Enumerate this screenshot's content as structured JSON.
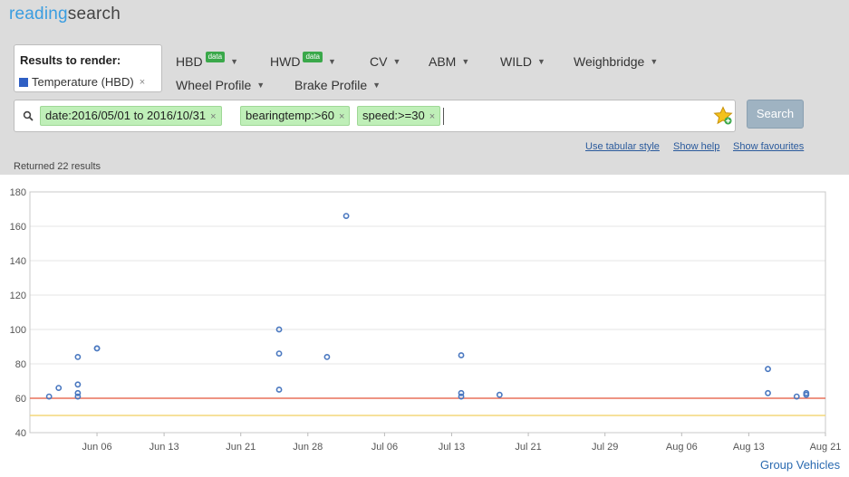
{
  "app": {
    "brand_part1": "reading",
    "brand_part2": "search"
  },
  "render_box": {
    "title": "Results to render:",
    "item": "Temperature (HBD)",
    "item_color": "#2f5fc4"
  },
  "menus": [
    {
      "label": "HBD",
      "badge": "data"
    },
    {
      "label": "HWD",
      "badge": "data"
    },
    {
      "label": "CV"
    },
    {
      "label": "ABM"
    },
    {
      "label": "WILD"
    },
    {
      "label": "Weighbridge"
    },
    {
      "label": "Wheel Profile"
    },
    {
      "label": "Brake Profile"
    }
  ],
  "search": {
    "tags": [
      "date:2016/05/01 to 2016/10/31",
      "bearingtemp:>60",
      "speed:>=30"
    ],
    "button": "Search",
    "remove_symbol": "×"
  },
  "links": {
    "tabular": "Use tabular style",
    "help": "Show help",
    "favourites": "Show favourites"
  },
  "status": "Returned 22 results",
  "footer": {
    "group_link": "Group Vehicles"
  },
  "chart_data": {
    "type": "scatter",
    "x_ticks": [
      "Jun 06",
      "Jun 13",
      "Jun 21",
      "Jun 28",
      "Jul 06",
      "Jul 13",
      "Jul 21",
      "Jul 29",
      "Aug 06",
      "Aug 13",
      "Aug 21"
    ],
    "y_ticks": [
      40,
      60,
      80,
      100,
      120,
      140,
      160,
      180
    ],
    "xlim": [
      "2016-05-30",
      "2016-08-21"
    ],
    "ylim": [
      40,
      180
    ],
    "grid": true,
    "points": [
      {
        "x": "2016-06-01",
        "y": 61
      },
      {
        "x": "2016-06-02",
        "y": 66
      },
      {
        "x": "2016-06-04",
        "y": 84
      },
      {
        "x": "2016-06-04",
        "y": 68
      },
      {
        "x": "2016-06-04",
        "y": 63
      },
      {
        "x": "2016-06-04",
        "y": 61
      },
      {
        "x": "2016-06-06",
        "y": 89
      },
      {
        "x": "2016-06-06",
        "y": 89
      },
      {
        "x": "2016-06-25",
        "y": 100
      },
      {
        "x": "2016-06-25",
        "y": 86
      },
      {
        "x": "2016-06-25",
        "y": 65
      },
      {
        "x": "2016-06-30",
        "y": 84
      },
      {
        "x": "2016-07-02",
        "y": 166
      },
      {
        "x": "2016-07-14",
        "y": 85
      },
      {
        "x": "2016-07-14",
        "y": 63
      },
      {
        "x": "2016-07-14",
        "y": 61
      },
      {
        "x": "2016-07-18",
        "y": 62
      },
      {
        "x": "2016-08-15",
        "y": 77
      },
      {
        "x": "2016-08-15",
        "y": 63
      },
      {
        "x": "2016-08-18",
        "y": 61
      },
      {
        "x": "2016-08-19",
        "y": 63
      },
      {
        "x": "2016-08-19",
        "y": 62
      }
    ],
    "threshold_lines": [
      {
        "y": 60,
        "color": "#e8705a"
      },
      {
        "y": 50,
        "color": "#f3d77a"
      }
    ],
    "point_color": "#4a78c0"
  }
}
